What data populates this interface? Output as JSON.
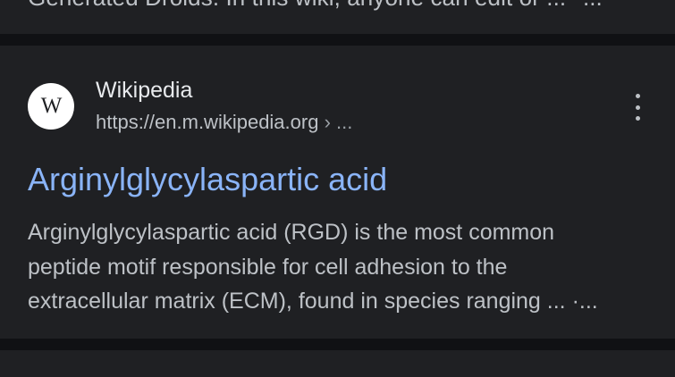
{
  "previous_result": {
    "snippet": "Generated Droids. In this wiki, anyone can edit or ...",
    "ellipsis": "..."
  },
  "result": {
    "favicon_letter": "W",
    "site_name": "Wikipedia",
    "url": "https://en.m.wikipedia.org",
    "url_separator": " › ...",
    "title": "Arginylglycylaspartic acid",
    "snippet_lines": [
      "Arginylglycylaspartic acid (RGD) is the most common",
      "peptide motif responsible for cell adhesion to the",
      "extracellular matrix (ECM), found in species ranging ... ·..."
    ]
  },
  "colors": {
    "background": "#101114",
    "card": "#1f2023",
    "link": "#8ab4f8",
    "text_primary": "#e8eaed",
    "text_secondary": "#bdc1c6"
  },
  "icons": {
    "favicon": "wikipedia-icon",
    "menu": "more-vert-icon"
  }
}
